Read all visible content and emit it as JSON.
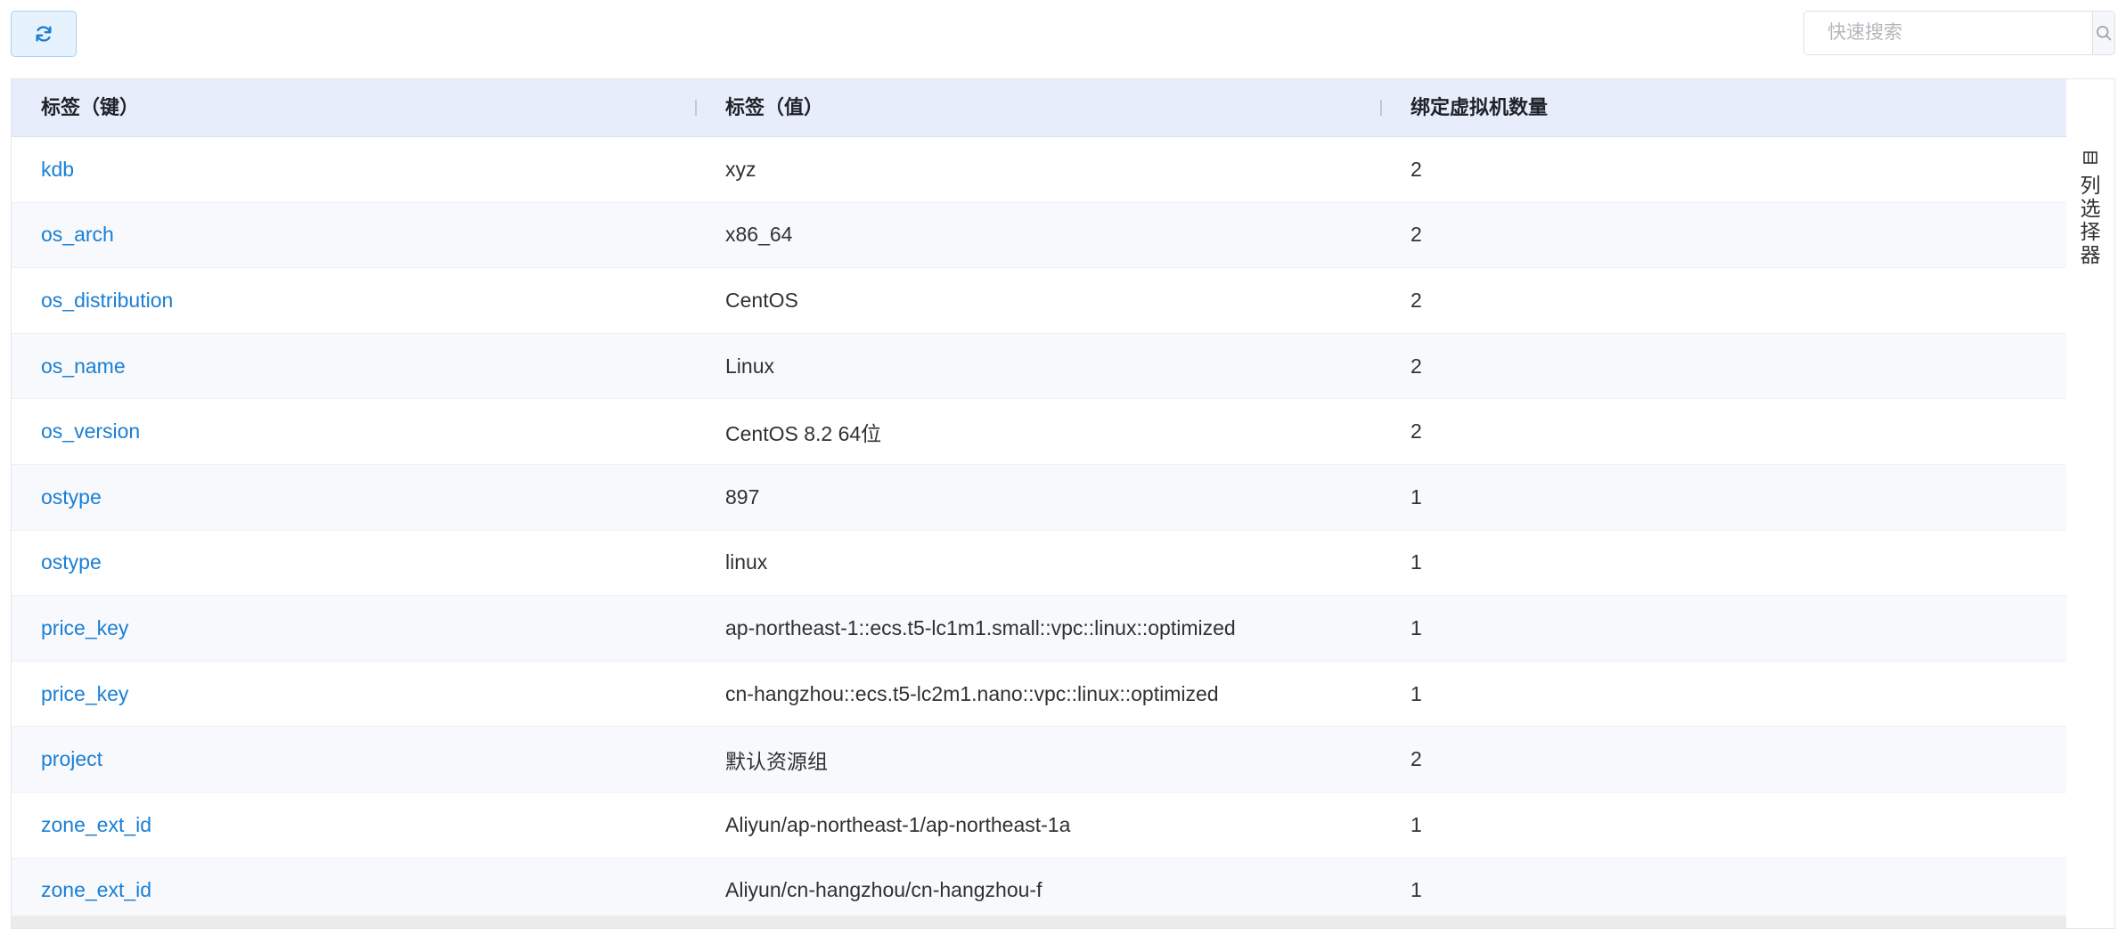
{
  "toolbar": {
    "refresh_icon": "refresh-icon",
    "search": {
      "placeholder": "快速搜索",
      "value": "",
      "icon": "search-icon"
    }
  },
  "table": {
    "columns": [
      {
        "label": "标签（键）"
      },
      {
        "label": "标签（值）"
      },
      {
        "label": "绑定虚拟机数量"
      }
    ],
    "rows": [
      {
        "key": "kdb",
        "value": "xyz",
        "count": "2"
      },
      {
        "key": "os_arch",
        "value": "x86_64",
        "count": "2"
      },
      {
        "key": "os_distribution",
        "value": "CentOS",
        "count": "2"
      },
      {
        "key": "os_name",
        "value": "Linux",
        "count": "2"
      },
      {
        "key": "os_version",
        "value": "CentOS 8.2 64位",
        "count": "2"
      },
      {
        "key": "ostype",
        "value": "897",
        "count": "1"
      },
      {
        "key": "ostype",
        "value": "linux",
        "count": "1"
      },
      {
        "key": "price_key",
        "value": "ap-northeast-1::ecs.t5-lc1m1.small::vpc::linux::optimized",
        "count": "1"
      },
      {
        "key": "price_key",
        "value": "cn-hangzhou::ecs.t5-lc2m1.nano::vpc::linux::optimized",
        "count": "1"
      },
      {
        "key": "project",
        "value": "默认资源组",
        "count": "2"
      },
      {
        "key": "zone_ext_id",
        "value": "Aliyun/ap-northeast-1/ap-northeast-1a",
        "count": "1"
      },
      {
        "key": "zone_ext_id",
        "value": "Aliyun/cn-hangzhou/cn-hangzhou-f",
        "count": "1"
      }
    ]
  },
  "column_picker": {
    "label": "列选择器",
    "icon": "columns-icon"
  },
  "colors": {
    "link": "#1a7fd4",
    "header_bg": "#e8edfb",
    "button_bg": "#e6f2fd",
    "stripe_bg": "#f8f9fc"
  }
}
